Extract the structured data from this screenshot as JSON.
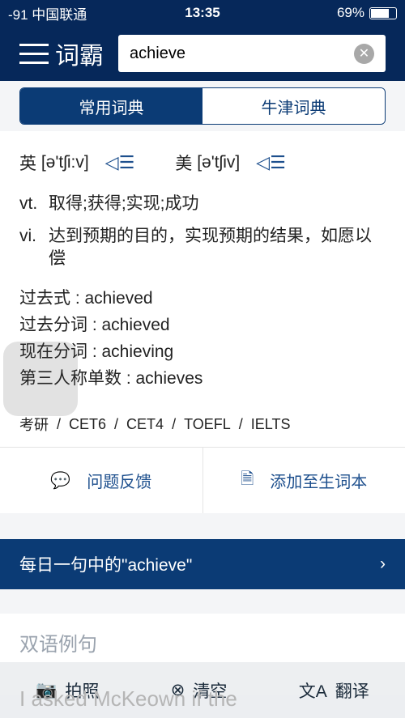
{
  "status": {
    "carrier": "-91 中国联通",
    "time": "13:35",
    "battery": "69%"
  },
  "header": {
    "logo": "词霸",
    "search_value": "achieve"
  },
  "tabs": [
    {
      "label": "常用词典",
      "active": true
    },
    {
      "label": "牛津词典",
      "active": false
    }
  ],
  "pron": {
    "uk_label": "英",
    "uk": "[ə'tʃi:v]",
    "us_label": "美",
    "us": "[ə'tʃiv]"
  },
  "definitions": [
    {
      "pos": "vt.",
      "text": "取得;获得;实现;成功"
    },
    {
      "pos": "vi.",
      "text": "达到预期的目的，实现预期的结果，如愿以偿"
    }
  ],
  "forms": [
    "过去式 : achieved",
    "过去分词 : achieved",
    "现在分词 : achieving",
    "第三人称单数 : achieves"
  ],
  "tags": [
    "考研",
    "CET6",
    "CET4",
    "TOEFL",
    "IELTS"
  ],
  "actions": {
    "feedback": "问题反馈",
    "add_word": "添加至生词本"
  },
  "daily": "每日一句中的\"achieve\"",
  "examples": {
    "title": "双语例句",
    "first_line": "I asked McKeown if the"
  },
  "bottom": {
    "photo": "拍照",
    "clear": "清空",
    "translate": "翻译"
  },
  "colors": {
    "navy": "#06285a",
    "accent": "#0b3b75"
  }
}
